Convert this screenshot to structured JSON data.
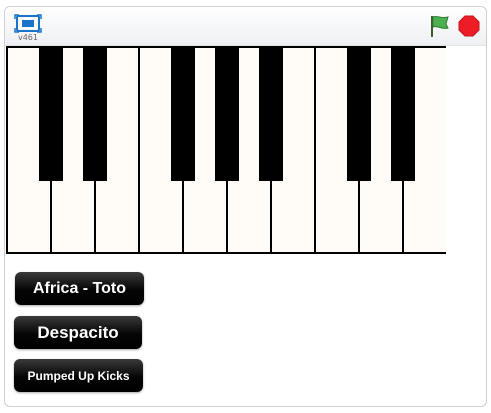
{
  "player": {
    "version": "v461",
    "fullscreen_icon": "fullscreen-icon",
    "green_flag_icon": "green-flag-icon",
    "stop_icon": "stop-sign-icon",
    "colors": {
      "flag": "#2e7d32",
      "stop": "#ee1c24",
      "fullscreen": "#1a73c8"
    }
  },
  "piano": {
    "white_key_count": 10,
    "white_key_color": "#fffcf7",
    "black_key_color": "#000000",
    "black_key_after_white": [
      0,
      1,
      3,
      4,
      5,
      7,
      8
    ]
  },
  "songs": [
    {
      "label": "Africa - Toto"
    },
    {
      "label": "Despacito"
    },
    {
      "label": "Pumped Up Kicks"
    }
  ]
}
